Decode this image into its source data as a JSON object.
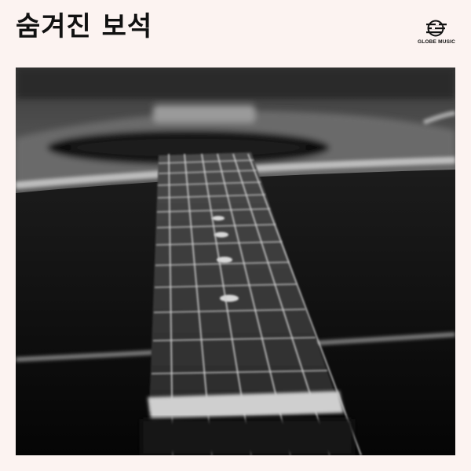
{
  "album": {
    "title": "숨겨진 보석",
    "label": "GLOBE MUSIC",
    "logo_icon": "globe-music-logo-icon",
    "cover_image": "acoustic-guitar-fretboard-photo",
    "background_color": "#fcf3f1"
  }
}
